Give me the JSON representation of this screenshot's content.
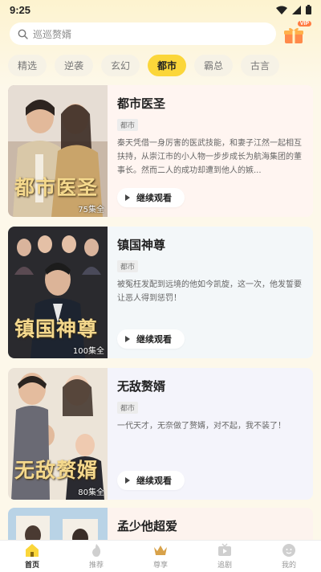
{
  "status_bar": {
    "time": "9:25"
  },
  "search": {
    "placeholder": "巡巡赘婿",
    "vip_label": "VIP"
  },
  "tabs": [
    {
      "label": "精选",
      "active": false
    },
    {
      "label": "逆袭",
      "active": false
    },
    {
      "label": "玄幻",
      "active": false
    },
    {
      "label": "都市",
      "active": true
    },
    {
      "label": "霸总",
      "active": false
    },
    {
      "label": "古言",
      "active": false
    }
  ],
  "dramas": [
    {
      "title": "都市医圣",
      "genre": "都市",
      "description": "秦天凭借一身厉害的医武技能，和妻子江然一起相互扶持，从崇江市的小人物一步步成长为航海集团的董事长。然而二人的成功却遭到他人的嫉...",
      "episodes": "75集全",
      "poster_text": "都市医圣",
      "continue_label": "继续观看"
    },
    {
      "title": "镇国神尊",
      "genre": "都市",
      "description": "被冤枉发配到远境的他如今凯旋，这一次，他发誓要让恶人得到惩罚！",
      "episodes": "100集全",
      "poster_text": "镇国神尊",
      "continue_label": "继续观看"
    },
    {
      "title": "无敌赘婿",
      "genre": "都市",
      "description": "一代天才，无奈做了赘婿，对不起，我不装了！",
      "episodes": "80集全",
      "poster_text": "无敌赘婿",
      "continue_label": "继续观看"
    },
    {
      "title": "孟少他超爱"
    }
  ],
  "bottom_nav": [
    {
      "label": "首页",
      "icon": "home-icon",
      "active": true
    },
    {
      "label": "推荐",
      "icon": "flame-icon",
      "active": false
    },
    {
      "label": "尊享",
      "icon": "crown-icon",
      "active": false
    },
    {
      "label": "追剧",
      "icon": "tv-icon",
      "active": false
    },
    {
      "label": "我的",
      "icon": "profile-icon",
      "active": false
    }
  ],
  "colors": {
    "accent": "#fbd63a",
    "background": "#fdf8ea",
    "vip": "#ff7b42"
  }
}
